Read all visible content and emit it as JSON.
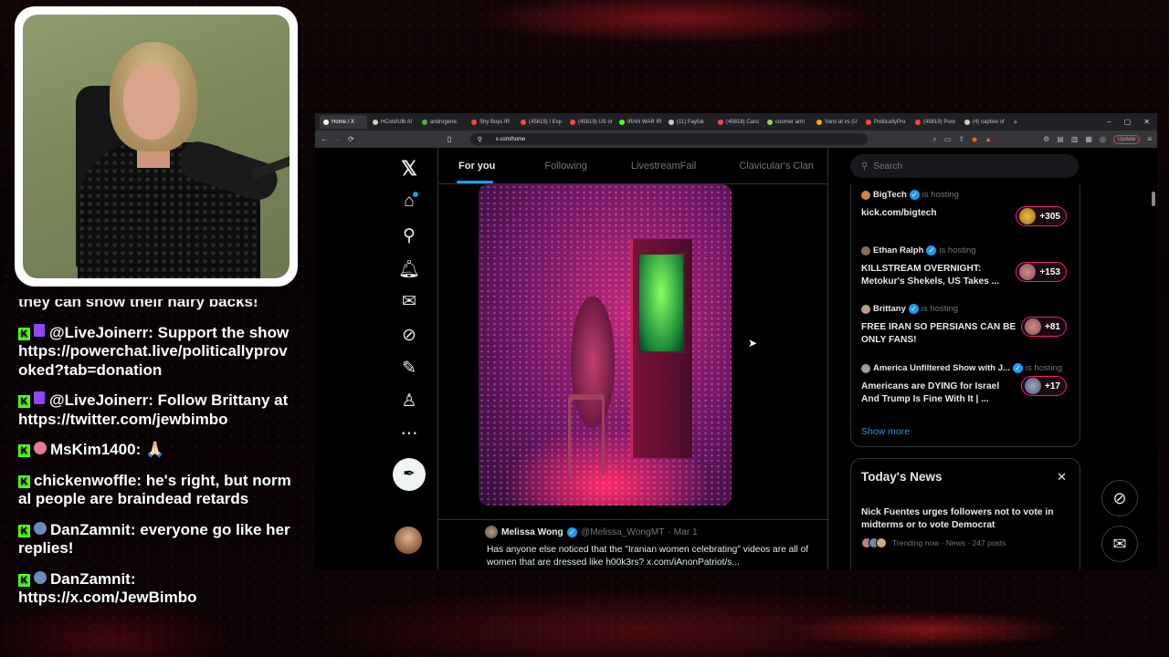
{
  "chat": {
    "cut_line": "they can show their hairy backs!",
    "messages": [
      {
        "user": "@LiveJoinerr",
        "sep": ": ",
        "text": "Support the show https://powerchat.live/politicallyprovoked?tab=donation"
      },
      {
        "user": "@LiveJoinerr",
        "sep": ": ",
        "text": "Follow Brittany at https://twitter.com/jewbimbo"
      },
      {
        "user": "MsKim1400",
        "sep": ": ",
        "text": "🙏🏻"
      },
      {
        "user": "chickenwoffle",
        "sep": ": ",
        "text": "he's right, but normal people are braindead retards"
      },
      {
        "user": "DanZamnit",
        "sep": ": ",
        "text": "everyone go like her replies!"
      },
      {
        "user": "DanZamnit",
        "sep": ":",
        "text": "https://x.com/JewBimbo"
      }
    ]
  },
  "browser": {
    "tabs": [
      "Home / X",
      "HCold/Ulb Al",
      "androgenic",
      "Shy Boys IR",
      "(45819) I Exp",
      "(45819) US or",
      "IRAN WAR IR",
      "(11) Fayfuk",
      "(45818) Canc",
      "coomer arm",
      "Vans at vs (U",
      "PoliticallyPro",
      "(45819) Pure",
      "(4) captive of"
    ],
    "url": "x.com/home",
    "update_label": "Update"
  },
  "x": {
    "center_tabs": [
      "For you",
      "Following",
      "LivestreamFail",
      "Clavicular's Clan"
    ],
    "search_placeholder": "Search",
    "tweet": {
      "name": "Melissa Wong",
      "handle": "@Melissa_WongMT",
      "date": "· Mar 1",
      "text": "Has anyone else noticed that the \"Iranian women celebrating\" videos are all of women that are dressed like h00k3rs? x.com/iAnonPatriot/s..."
    },
    "hosts": [
      {
        "name": "BigTech",
        "status": "is hosting",
        "title": "kick.com/bigtech",
        "count": "+305"
      },
      {
        "name": "Ethan Ralph",
        "status": "is hosting",
        "title": "KILLSTREAM OVERNIGHT: Metokur's Shekels, US Takes ...",
        "count": "+153"
      },
      {
        "name": "Brittany",
        "status": "is hosting",
        "title": "FREE IRAN SO PERSIANS CAN BE ONLY FANS!",
        "count": "+81"
      },
      {
        "name": "America Unfiltered Show with J...",
        "status": "is hosting",
        "title": "Americans are DYING for Israel And Trump Is Fine With It | ...",
        "count": "+17"
      }
    ],
    "show_more": "Show more",
    "news": {
      "heading": "Today's News",
      "headline": "Nick Fuentes urges followers not to vote in midterms or to vote Democrat",
      "meta": "Trending now · News · 247 posts"
    }
  }
}
